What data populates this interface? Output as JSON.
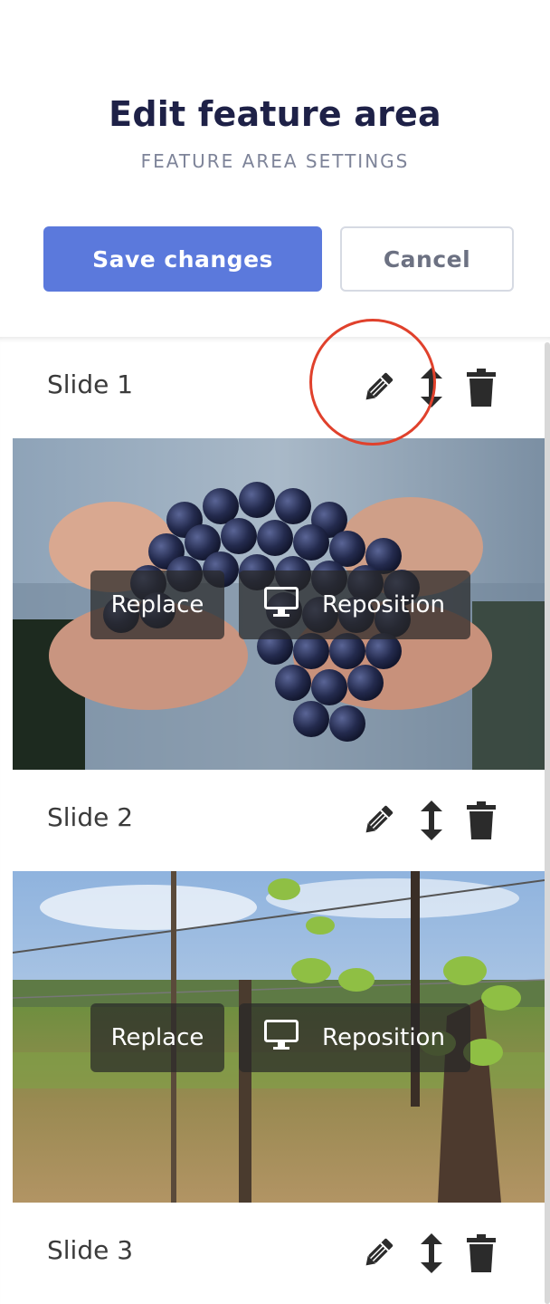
{
  "header": {
    "title": "Edit feature area",
    "subtitle": "FEATURE AREA SETTINGS",
    "save_label": "Save changes",
    "cancel_label": "Cancel"
  },
  "slides": [
    {
      "label": "Slide 1",
      "replace_label": "Replace",
      "reposition_label": "Reposition",
      "image": "grapes-in-hands"
    },
    {
      "label": "Slide 2",
      "replace_label": "Replace",
      "reposition_label": "Reposition",
      "image": "vineyard"
    },
    {
      "label": "Slide 3"
    }
  ],
  "icons": {
    "edit": "pencil-icon",
    "move": "move-vertical-icon",
    "delete": "trash-icon",
    "reposition": "monitor-icon"
  },
  "colors": {
    "primary": "#5b79dc",
    "title": "#1e2147",
    "highlight": "#e0412c"
  }
}
